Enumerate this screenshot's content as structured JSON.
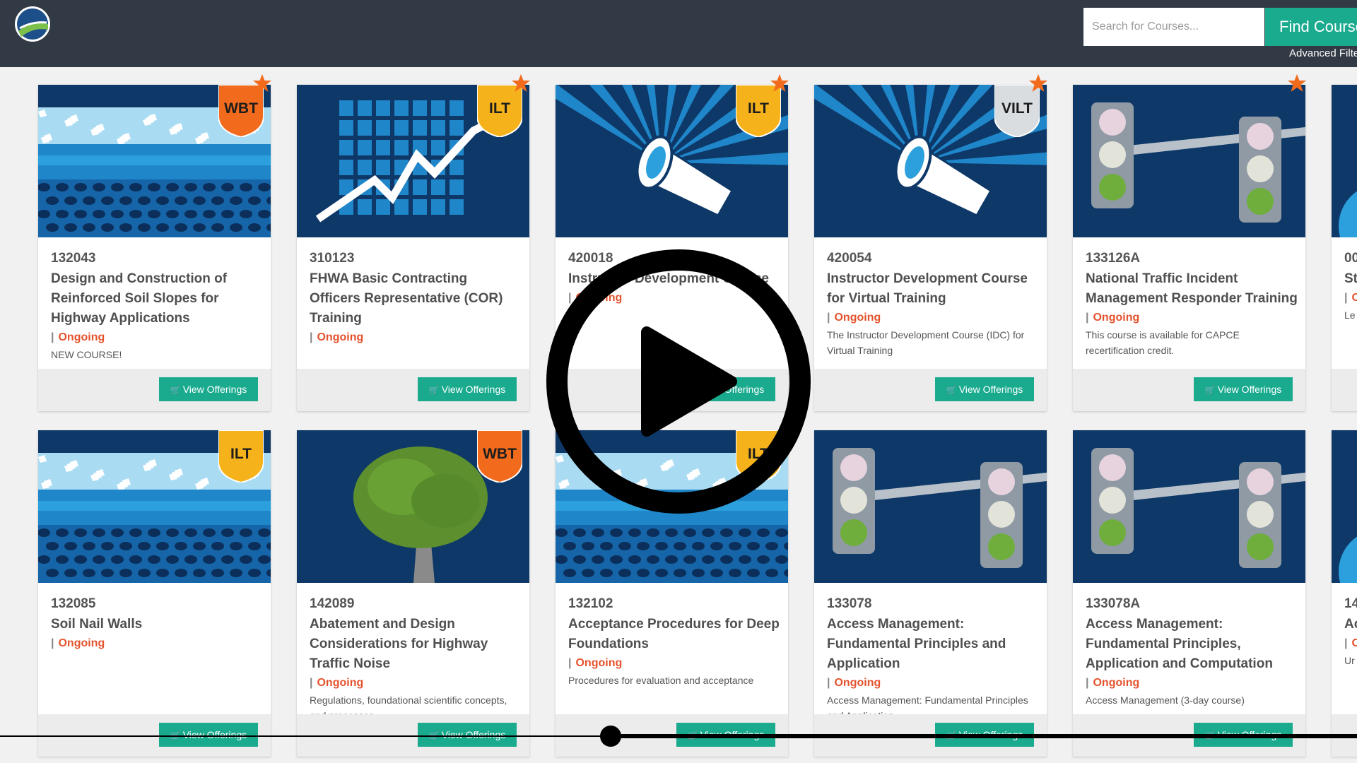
{
  "header": {
    "search_placeholder": "Search for Courses...",
    "find_button": "Find Courses",
    "advanced_filters": "Advanced Filters"
  },
  "cards": [
    {
      "code": "132043",
      "title": "Design and Construction of Reinforced Soil Slopes for Highway Applications",
      "status": "Ongoing",
      "desc": "NEW COURSE!",
      "badge": "WBT",
      "art": "soil",
      "starred": true,
      "button": "View Offerings"
    },
    {
      "code": "310123",
      "title": "FHWA Basic Contracting Officers Representative (COR) Training",
      "status": "Ongoing",
      "desc": "",
      "badge": "ILT",
      "art": "chart",
      "starred": true,
      "button": "View Offerings"
    },
    {
      "code": "420018",
      "title": "Instructor Development Course",
      "status": "Ongoing",
      "desc": "",
      "badge": "ILT",
      "art": "megaphone",
      "starred": true,
      "button": "View Offerings"
    },
    {
      "code": "420054",
      "title": "Instructor Development Course for Virtual Training",
      "status": "Ongoing",
      "desc": "The Instructor Development Course (IDC) for Virtual Training",
      "badge": "VILT",
      "art": "megaphone",
      "starred": true,
      "button": "View Offerings"
    },
    {
      "code": "133126A",
      "title": "National Traffic Incident Management Responder Training",
      "status": "Ongoing",
      "desc": "This course is available for CAPCE recertification credit.",
      "badge": "",
      "art": "traffic",
      "starred": true,
      "button": "View Offerings"
    },
    {
      "code": "132085",
      "title": "Soil Nail Walls",
      "status": "Ongoing",
      "desc": "",
      "badge": "ILT",
      "art": "soil",
      "starred": false,
      "button": "View Offerings"
    },
    {
      "code": "142089",
      "title": "Abatement and Design Considerations for Highway Traffic Noise",
      "status": "Ongoing",
      "desc": "Regulations, foundational scientific concepts, and processes",
      "badge": "WBT",
      "art": "tree",
      "starred": false,
      "button": "View Offerings"
    },
    {
      "code": "132102",
      "title": "Acceptance Procedures for Deep Foundations",
      "status": "Ongoing",
      "desc": "Procedures for evaluation and acceptance",
      "badge": "ILT",
      "art": "soil",
      "starred": false,
      "button": "View Offerings"
    },
    {
      "code": "133078",
      "title": "Access Management: Fundamental Principles and Application",
      "status": "Ongoing",
      "desc": "Access Management: Fundamental Principles and Application",
      "badge": "",
      "art": "traffic",
      "starred": false,
      "button": "View Offerings"
    },
    {
      "code": "133078A",
      "title": "Access Management: Fundamental Principles, Application and Computation",
      "status": "Ongoing",
      "desc": "Access Management (3-day course)",
      "badge": "",
      "art": "traffic",
      "starred": false,
      "button": "View Offerings"
    }
  ],
  "partial_cards": [
    {
      "code": "00",
      "title": "St Bl",
      "status": "O",
      "desc": "Le co"
    },
    {
      "code": "14",
      "title": "Ac Co",
      "status": "O",
      "desc": "Ur co"
    }
  ],
  "video": {
    "progress": 0.45
  },
  "colors": {
    "header": "#323a45",
    "accent": "#1aaa8e",
    "status": "#e5532d",
    "art_bg": "#0e3868"
  },
  "icons": {
    "logo": "nhi-logo",
    "play": "play-icon",
    "cart": "cart-icon",
    "star": "star-icon"
  }
}
